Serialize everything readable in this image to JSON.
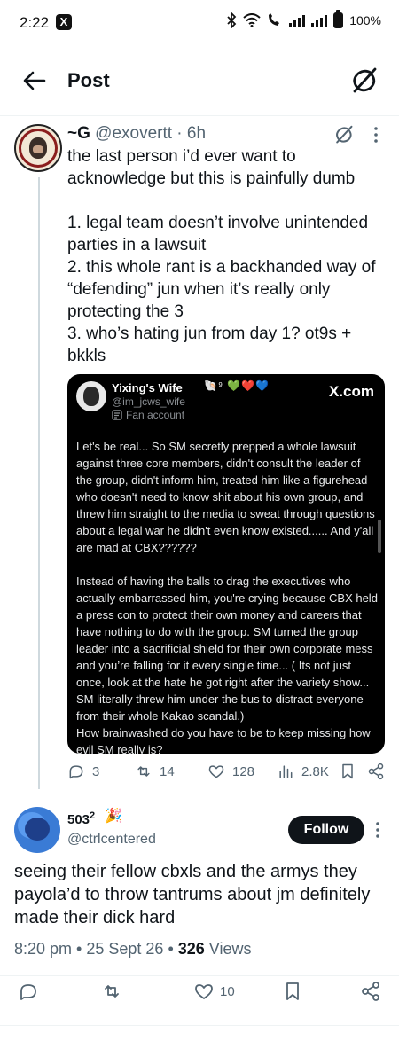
{
  "status_bar": {
    "time": "2:22",
    "app_badge": "X",
    "battery": "100%"
  },
  "header": {
    "title": "Post"
  },
  "tweet1": {
    "display_name": "~G",
    "handle": "@exovertt",
    "time": "6h",
    "separator": " · ",
    "text": "the last person i’d ever want to acknowledge but this is painfully dumb\n\n1. legal team doesn’t involve unintended parties in a lawsuit\n2. this whole rant is a backhanded way of “defending” jun when it’s really only protecting the 3\n3. who’s hating jun from day 1? ot9s + bkkls",
    "embed": {
      "name": "Yixing's Wife",
      "name_emojis": "🐚⁹ 💚❤️💙",
      "handle": "@im_jcws_wife",
      "label": "Fan account",
      "source": "X.com",
      "body": "Let's be real... So SM secretly prepped a whole lawsuit against three core members, didn't consult the leader of the group, didn't inform him, treated him like a figurehead who doesn't need to know shit about his own group, and threw him straight to the media to sweat through questions about a legal war he didn't even know existed...... And y'all are mad at CBX??????\n\nInstead of having the balls to drag the executives who actually embarrassed him, you're crying because CBX held a press con to protect their own money and careers that have nothing to do with the group. SM turned the group leader into a sacrificial shield for their own corporate mess and you’re falling for it every single time... ( Its not just once, look at the hate he got right after the variety show... SM literally threw him under the bus to distract everyone from their whole Kakao scandal.)\nHow brainwashed do you have to be to keep missing how evil SM really is?"
    },
    "stats": {
      "replies": "3",
      "reposts": "14",
      "likes": "128",
      "views": "2.8K"
    }
  },
  "tweet2": {
    "display_name": "503",
    "superscript": "2",
    "emoji": "🎉",
    "handle": "@ctrlcentered",
    "follow_label": "Follow",
    "text": "seeing their fellow cbxls and the armys they payola’d to throw tantrums about jm definitely made their dick hard",
    "time": "8:20 pm",
    "date": "25 Sept 26",
    "views_count": "326",
    "views_label": " Views",
    "dot": " • ",
    "stats": {
      "likes": "10"
    }
  },
  "icons": [
    "x-app-icon",
    "bluetooth-icon",
    "wifi-icon",
    "signal-icon",
    "battery-icon",
    "back-arrow-icon",
    "grok-icon",
    "more-icon",
    "reply-icon",
    "repost-icon",
    "like-icon",
    "views-icon",
    "bookmark-icon",
    "share-icon",
    "verified-icon",
    "fan-account-icon"
  ],
  "colors": {
    "text": "#0f1419",
    "secondary": "#536471",
    "embed_bg": "#000000",
    "follow_bg": "#0f1419"
  }
}
